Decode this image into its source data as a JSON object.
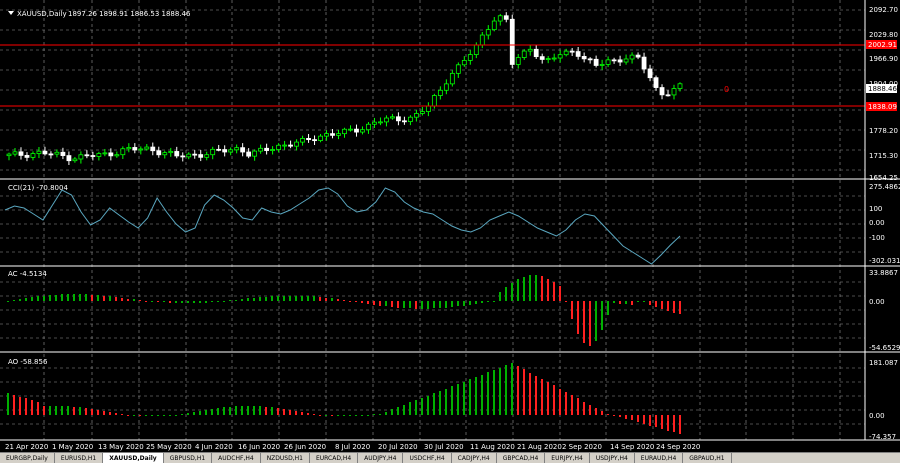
{
  "window": {
    "symbol_label": "XAUUSD,Daily",
    "ohlc_label": "1897.26 1898.91 1886.53 1888.46"
  },
  "colors": {
    "background": "#000000",
    "bull": "#00ff00",
    "bear": "#ffffff",
    "grid": "#9a9a9a",
    "level_line": "#ff0000",
    "cci_line": "#5aa7c0",
    "ac_up": "#00b000",
    "ac_down": "#ff2020"
  },
  "price_axis": {
    "ticks": [
      "2092.70",
      "2029.80",
      "1966.90",
      "1904.00",
      "1778.20",
      "1715.30",
      "1654.25"
    ],
    "current_price": "1888.46",
    "resistance_label": "2002.91",
    "support_label": "1838.09",
    "marker": "0"
  },
  "cci": {
    "title": "CCI(21) -70.8004",
    "ticks": [
      "275.4862",
      "100",
      "0.00",
      "-100",
      "-302.0316"
    ]
  },
  "ac": {
    "title": "AC -4.5134",
    "ticks": [
      "33.8867",
      "0.00",
      "-54.6529"
    ]
  },
  "ao": {
    "title": "AO -58.856",
    "ticks": [
      "181.087",
      "0.00",
      "-74.357"
    ]
  },
  "time_axis": [
    "21 Apr 2020",
    "1 May 2020",
    "13 May 2020",
    "25 May 2020",
    "4 Jun 2020",
    "16 Jun 2020",
    "26 Jun 2020",
    "8 Jul 2020",
    "20 Jul 2020",
    "30 Jul 2020",
    "11 Aug 2020",
    "21 Aug 2020",
    "2 Sep 2020",
    "14 Sep 2020",
    "24 Sep 2020"
  ],
  "tabs": [
    "EURGBP,Daily",
    "EURUSD,H1",
    "XAUUSD,Daily",
    "GBPUSD,H1",
    "AUDCHF,H4",
    "NZDUSD,H1",
    "EURCAD,H4",
    "AUDJPY,H4",
    "USDCHF,H4",
    "CADJPY,H4",
    "GBPCAD,H4",
    "EURJPY,H4",
    "USDJPY,H4",
    "EURAUD,H4",
    "GBPAUD,H1"
  ],
  "active_tab": 2
}
